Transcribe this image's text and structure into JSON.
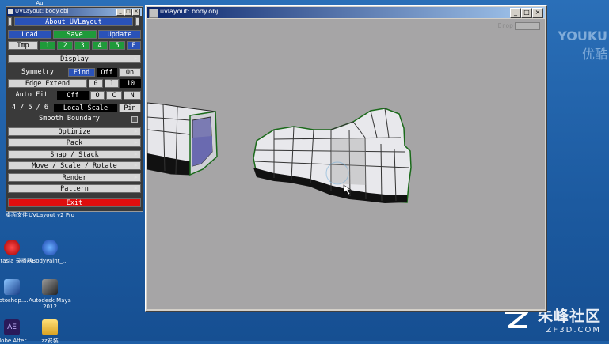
{
  "desktop": {
    "icons": [
      {
        "label": "桌面文件",
        "color": "#d8d8d8"
      },
      {
        "label": "UVLayout v2 Pro",
        "color": "#d8d8d8"
      },
      {
        "label": "amtasia 录播器",
        "color": "#d01818"
      },
      {
        "label": "BodyPaint_...",
        "color": "#2a72d8"
      },
      {
        "label": "hotoshop....",
        "color": "#2a52a8"
      },
      {
        "label": "Autodesk Maya 2012",
        "color": "#2a2a2a"
      },
      {
        "label": "dobe After",
        "color": "#3a2a6a"
      },
      {
        "label": "zz安装",
        "color": "#e8c24a"
      }
    ],
    "top_label": "Au"
  },
  "watermarks": {
    "youku_en": "YOUKU",
    "youku_cn": "优酷",
    "zf3d_cn": "朱峰社区",
    "zf3d_en": "ZF3D.COM"
  },
  "viewport": {
    "title": "uvlayout: body.obj",
    "drop_label": "Drop"
  },
  "panel": {
    "title": "UVLayout: body.obj",
    "about": "About UVLayout",
    "load": "Load",
    "save": "Save",
    "update": "Update",
    "tmp_label": "Tmp",
    "tmp_slots": [
      "1",
      "2",
      "3",
      "4",
      "5",
      "E"
    ],
    "display": "Display",
    "symmetry_label": "Symmetry",
    "symmetry_find": "Find",
    "symmetry_off": "Off",
    "symmetry_on": "On",
    "edge_extend_label": "Edge Extend",
    "edge_extend_0": "0",
    "edge_extend_1": "1",
    "edge_extend_10": "10",
    "auto_fit_label": "Auto Fit",
    "auto_fit_off": "Off",
    "auto_fit_o": "O",
    "auto_fit_c": "C",
    "auto_fit_n": "N",
    "local_scale_prefix": "4 / 5 / 6",
    "local_scale": "Local Scale",
    "pin": "Pin",
    "smooth_boundary": "Smooth Boundary",
    "menus": [
      "Optimize",
      "Pack",
      "Snap / Stack",
      "Move / Scale / Rotate",
      "Render",
      "Pattern"
    ],
    "exit": "Exit"
  },
  "colors": {
    "panel_blue": "#2a52b8",
    "panel_green": "#1f9a3a",
    "exit_red": "#e00e0e",
    "viewport_bg": "#a6a5a6",
    "mesh_outline": "#1a6a1a"
  }
}
